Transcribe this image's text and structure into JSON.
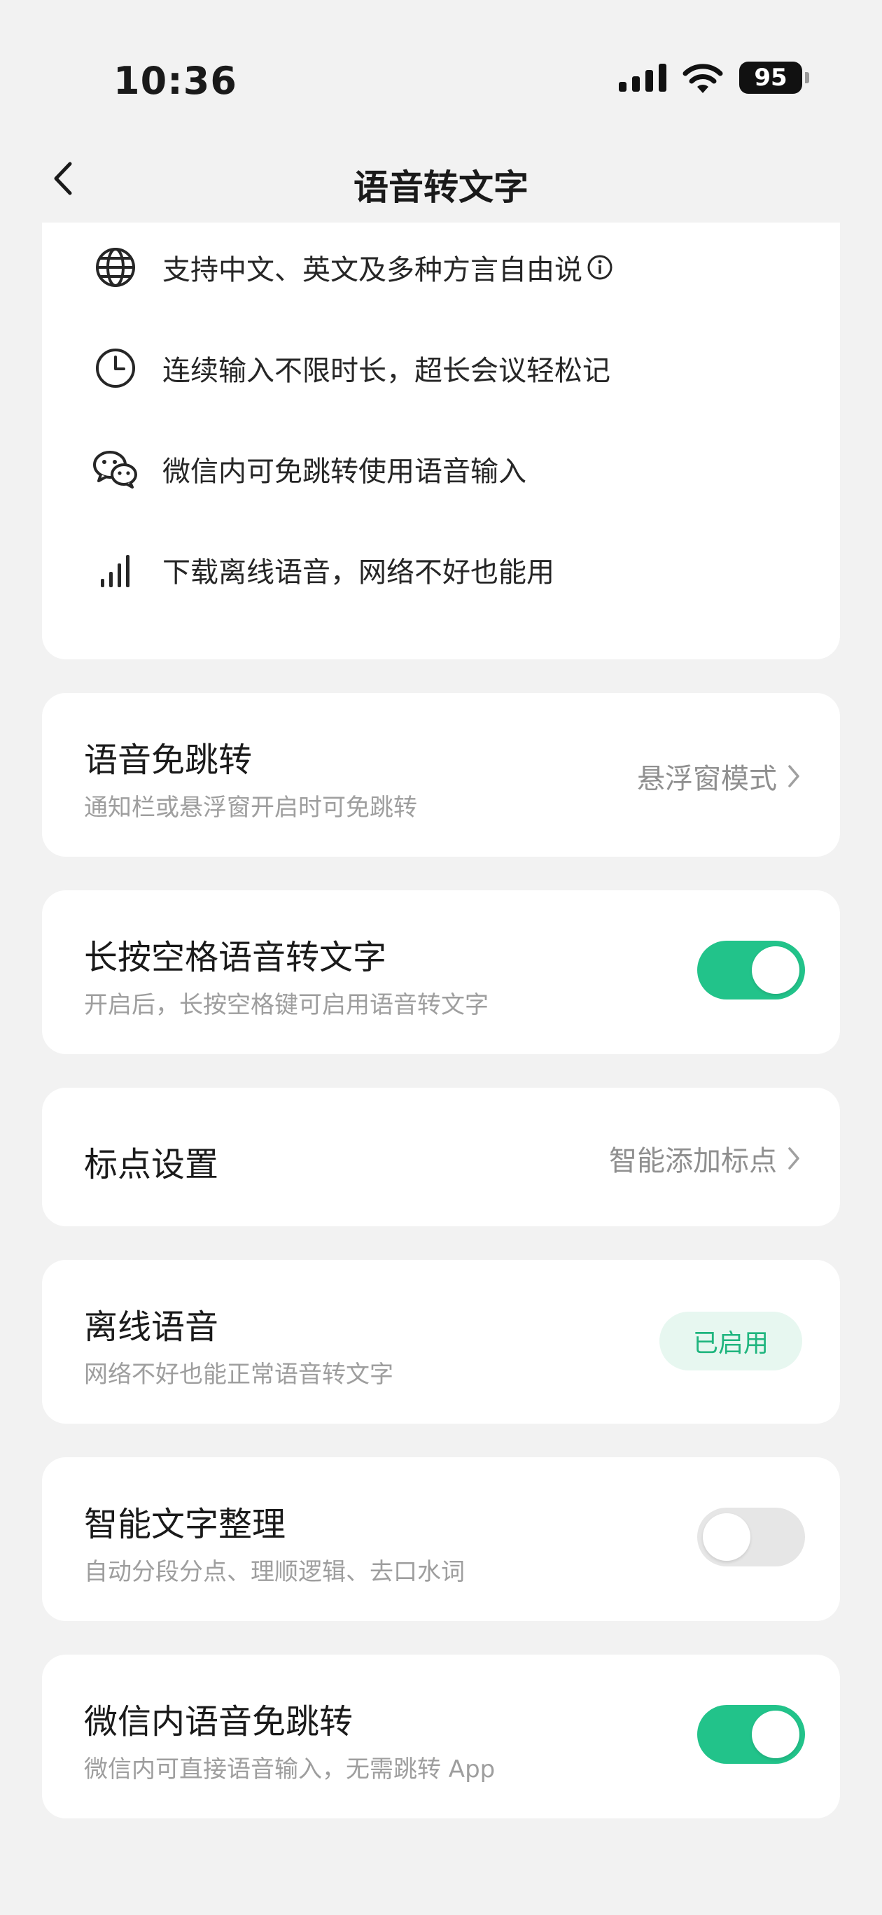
{
  "status_bar": {
    "time": "10:36",
    "battery": "95"
  },
  "nav": {
    "title": "语音转文字"
  },
  "features": [
    {
      "icon": "globe-icon",
      "text": "支持中文、英文及多种方言自由说"
    },
    {
      "icon": "clock-icon",
      "text": "连续输入不限时长，超长会议轻松记"
    },
    {
      "icon": "wechat-icon",
      "text": "微信内可免跳转使用语音输入"
    },
    {
      "icon": "signal-bars-icon",
      "text": "下载离线语音，网络不好也能用"
    }
  ],
  "settings": {
    "voice_no_jump": {
      "title": "语音免跳转",
      "subtitle": "通知栏或悬浮窗开启时可免跳转",
      "value": "悬浮窗模式"
    },
    "long_press_space": {
      "title": "长按空格语音转文字",
      "subtitle": "开启后，长按空格键可启用语音转文字",
      "enabled": true
    },
    "punctuation": {
      "title": "标点设置",
      "value": "智能添加标点"
    },
    "offline_voice": {
      "title": "离线语音",
      "subtitle": "网络不好也能正常语音转文字",
      "badge": "已启用"
    },
    "smart_text": {
      "title": "智能文字整理",
      "subtitle": "自动分段分点、理顺逻辑、去口水词",
      "enabled": false
    },
    "wechat_voice": {
      "title": "微信内语音免跳转",
      "subtitle": "微信内可直接语音输入，无需跳转 App",
      "enabled": true
    }
  },
  "colors": {
    "accent": "#22c38a",
    "badge_bg": "#e7f7f0",
    "badge_text": "#1fb57e",
    "background": "#f2f2f2"
  }
}
